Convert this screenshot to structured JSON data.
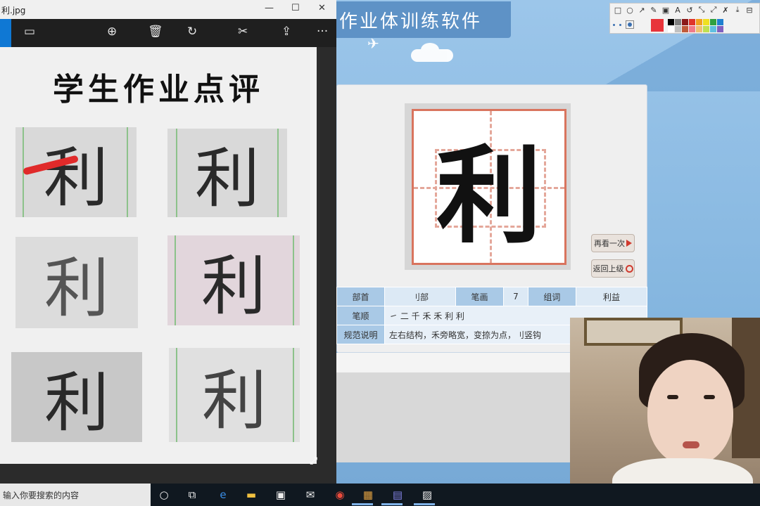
{
  "photos_window": {
    "title": "利.jpg",
    "controls": {
      "minimize": "—",
      "maximize": "☐",
      "close": "✕"
    },
    "toolbar": {
      "zoom": "⊕",
      "delete": "🗑",
      "rotate": "↻",
      "edit": "✂",
      "share": "⇪",
      "more": "···"
    },
    "image": {
      "heading": "学生作业点评",
      "samples": [
        "利",
        "利",
        "利",
        "利",
        "利",
        "利"
      ]
    }
  },
  "app": {
    "title": "作业体训练软件",
    "character": "利",
    "buttons": {
      "replay": "再看一次",
      "back": "返回上级"
    },
    "table": {
      "radical_label": "部首",
      "radical_value": "刂部",
      "strokes_label": "笔画",
      "strokes_value": "7",
      "words_label": "组词",
      "words_value": "利益",
      "order_label": "笔顺",
      "order_value": "㇀ 二 千 禾 禾 利 利",
      "spec_label": "规范说明",
      "spec_value": "左右结构，禾旁略宽，变捺为点，刂竖钩"
    }
  },
  "annotation_toolbar": {
    "tools": [
      "□",
      "○",
      "↗",
      "✎",
      "▣",
      "A",
      "↺",
      "⤡",
      "⤢",
      "✗",
      "⤓",
      "⊟"
    ],
    "colors": [
      "#000000",
      "#808080",
      "#8b1a1a",
      "#e0342a",
      "#f0a020",
      "#f0e020",
      "#30a040",
      "#2080d0",
      "#ffffff",
      "#c0c0c0",
      "#c05a3a",
      "#f07a8a",
      "#f0c070",
      "#c0e050",
      "#60c0e0",
      "#8060c0"
    ],
    "selected_color": "#e8343a"
  },
  "taskbar": {
    "search_placeholder": "输入你要搜索的内容",
    "icons": [
      "cortana-icon",
      "task-view-icon",
      "edge-icon",
      "file-explorer-icon",
      "store-icon",
      "mail-icon",
      "chrome-icon",
      "app-icon",
      "app2-icon",
      "photos-icon"
    ]
  }
}
